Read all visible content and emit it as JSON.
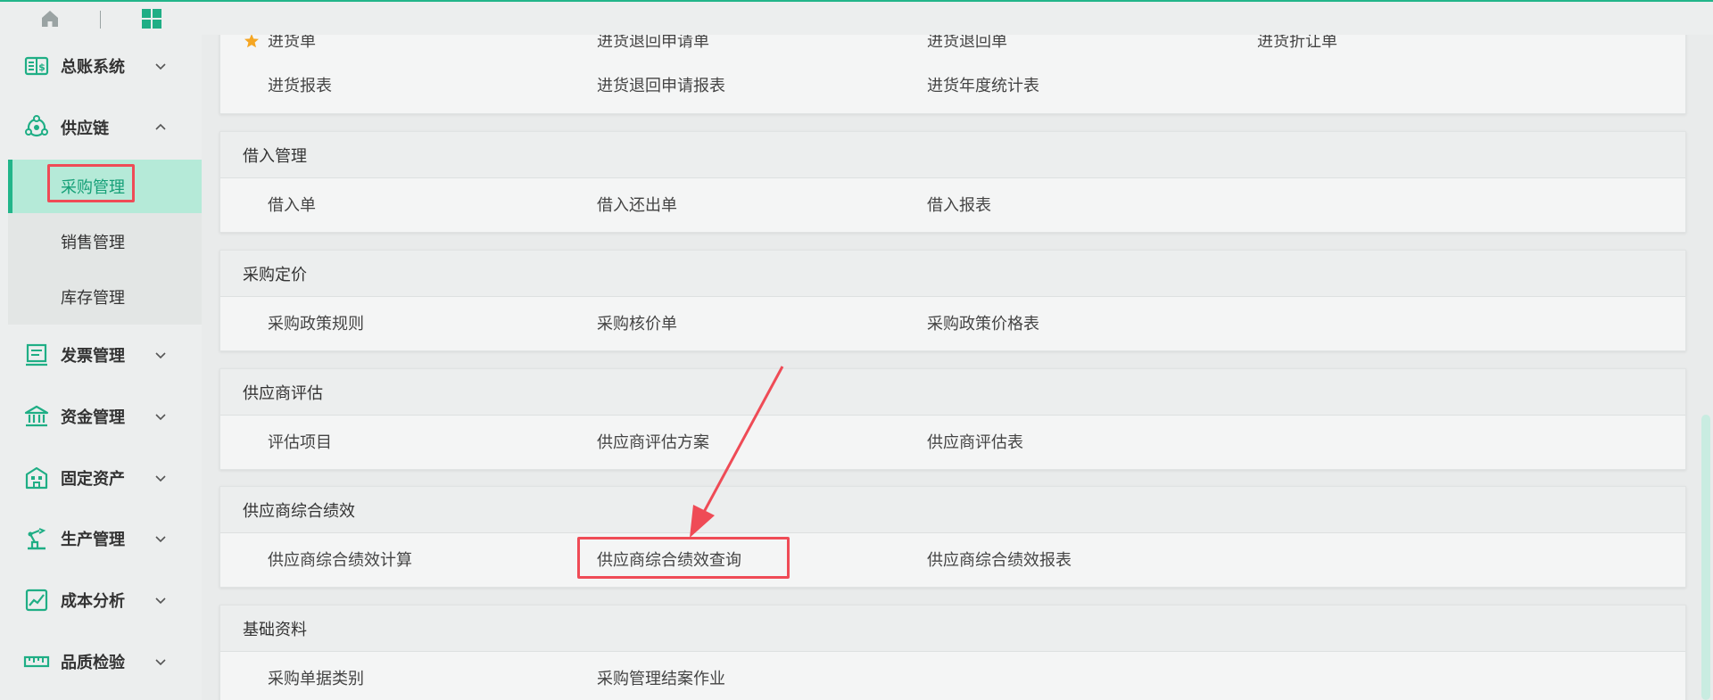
{
  "topbar": {
    "home_icon": "home-icon",
    "apps_icon": "grid-apps-icon",
    "accent": "#22b58a"
  },
  "sidebar": {
    "groups": [
      {
        "label": "总账系统",
        "icon": "ledger-icon",
        "expanded": false
      },
      {
        "label": "供应链",
        "icon": "supply-chain-icon",
        "expanded": true
      },
      {
        "label": "发票管理",
        "icon": "invoice-icon",
        "expanded": false
      },
      {
        "label": "资金管理",
        "icon": "bank-icon",
        "expanded": false
      },
      {
        "label": "固定资产",
        "icon": "building-icon",
        "expanded": false
      },
      {
        "label": "生产管理",
        "icon": "robot-arm-icon",
        "expanded": false
      },
      {
        "label": "成本分析",
        "icon": "chart-icon",
        "expanded": false
      },
      {
        "label": "品质检验",
        "icon": "ruler-icon",
        "expanded": false
      }
    ],
    "sub_items": [
      {
        "label": "采购管理",
        "active": true
      },
      {
        "label": "销售管理",
        "active": false
      },
      {
        "label": "库存管理",
        "active": false
      }
    ]
  },
  "content": {
    "card_top": {
      "rows": [
        [
          "进货单",
          "进货退回申请单",
          "进货退回单",
          "进货折让单"
        ],
        [
          "进货报表",
          "进货退回申请报表",
          "进货年度统计表"
        ]
      ]
    },
    "sections": [
      {
        "title": "借入管理",
        "items": [
          "借入单",
          "借入还出单",
          "借入报表"
        ]
      },
      {
        "title": "采购定价",
        "items": [
          "采购政策规则",
          "采购核价单",
          "采购政策价格表"
        ]
      },
      {
        "title": "供应商评估",
        "items": [
          "评估项目",
          "供应商评估方案",
          "供应商评估表"
        ]
      },
      {
        "title": "供应商综合绩效",
        "items": [
          "供应商综合绩效计算",
          "供应商综合绩效查询",
          "供应商综合绩效报表"
        ]
      },
      {
        "title": "基础资料",
        "items": [
          "采购单据类别",
          "采购管理结案作业"
        ]
      }
    ]
  },
  "annotation": {
    "color": "#ef4b56"
  }
}
